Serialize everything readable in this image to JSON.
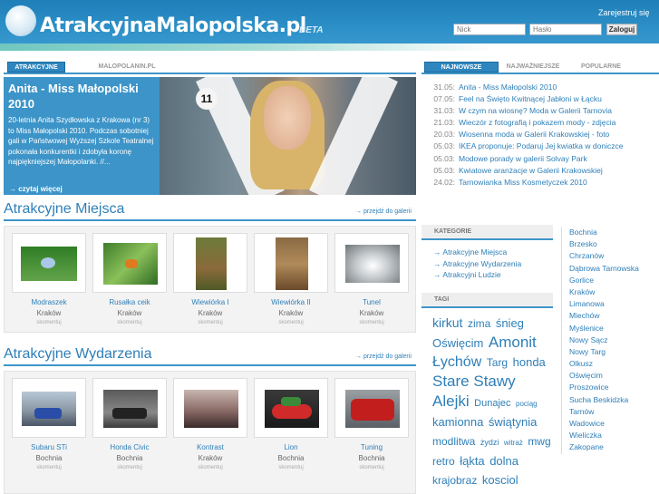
{
  "header": {
    "site_name": "AtrakcyjnaMalopolska.pl",
    "beta": "BETA",
    "register": "Zarejestruj się",
    "login_placeholder": "Nick",
    "password_placeholder": "Hasło",
    "login_button": "Zaloguj"
  },
  "left_tabs": [
    "ATRAKCYJNE",
    "MALOPOLANIN.PL"
  ],
  "right_tabs": [
    "NAJNOWSZE",
    "NAJWAŻNIEJSZE",
    "POPULARNE"
  ],
  "featured": {
    "title": "Anita - Miss Małopolski 2010",
    "description": "20-letnia Anita Szydłowska z Krakowa (nr 3) to Miss Małopolski 2010. Podczas sobotniej gali w Państwowej Wyższej Szkole Teatralnej pokonała konkurentki i zdobyła koronę najpiękniejszej Małopolanki. //...",
    "more": "czytaj więcej",
    "number": "11"
  },
  "news": [
    {
      "date": "31.05:",
      "title": "Anita - Miss Małopolski 2010"
    },
    {
      "date": "07.05:",
      "title": "Feel na Święto Kwitnącej Jabłoni w Łącku"
    },
    {
      "date": "31.03:",
      "title": "W czym na wiosnę? Moda w Galerii Tarnovia"
    },
    {
      "date": "21.03:",
      "title": "Wieczór z fotografią i pokazem mody - zdjęcia"
    },
    {
      "date": "20.03:",
      "title": "Wiosenna moda w Galerii Krakowskiej - foto"
    },
    {
      "date": "05.03:",
      "title": "IKEA proponuje: Podaruj Jej kwiatka w doniczce"
    },
    {
      "date": "05.03:",
      "title": "Modowe porady w galerii Solvay Park"
    },
    {
      "date": "05.03:",
      "title": "Kwiatowe aranżacje w Galerii Krakowskiej"
    },
    {
      "date": "24.02:",
      "title": "Tarnowianka Miss Kosmetyczek 2010"
    }
  ],
  "places": {
    "title": "Atrakcyjne Miejsca",
    "link": "przejdź do galerii",
    "items": [
      {
        "title": "Modraszek",
        "location": "Kraków",
        "comments": "skomentuj"
      },
      {
        "title": "Rusałka ceik",
        "location": "Kraków",
        "comments": "skomentuj"
      },
      {
        "title": "Wiewiórka I",
        "location": "Kraków",
        "comments": "skomentuj"
      },
      {
        "title": "Wiewiórka II",
        "location": "Kraków",
        "comments": "skomentuj"
      },
      {
        "title": "Tunel",
        "location": "Kraków",
        "comments": "skomentuj"
      }
    ]
  },
  "events": {
    "title": "Atrakcyjne Wydarzenia",
    "link": "przejdź do galerii",
    "items": [
      {
        "title": "Subaru STi",
        "location": "Bochnia",
        "comments": "skomentuj"
      },
      {
        "title": "Honda Civic",
        "location": "Bochnia",
        "comments": "skomentuj"
      },
      {
        "title": "Kontrast",
        "location": "Kraków",
        "comments": "skomentuj"
      },
      {
        "title": "Lion",
        "location": "Bochnia",
        "comments": "skomentuj"
      },
      {
        "title": "Tuning",
        "location": "Bochnia",
        "comments": "skomentuj"
      }
    ]
  },
  "categories": {
    "title": "KATEGORIE",
    "items": [
      "Atrakcyjne Miejsca",
      "Atrakcyjne Wydarzenia",
      "Atrakcyjni Ludzie"
    ]
  },
  "tags": {
    "title": "TAGI",
    "items": [
      {
        "text": "kirkut",
        "size": 14
      },
      {
        "text": "zima",
        "size": 12
      },
      {
        "text": "śnieg",
        "size": 13
      },
      {
        "text": "Oświęcim",
        "size": 13
      },
      {
        "text": "Amonit",
        "size": 17
      },
      {
        "text": "Łychów",
        "size": 16
      },
      {
        "text": "Targ",
        "size": 12
      },
      {
        "text": "honda",
        "size": 13
      },
      {
        "text": "Stare Stawy",
        "size": 17
      },
      {
        "text": "Alejki",
        "size": 17
      },
      {
        "text": "Dunajec",
        "size": 11
      },
      {
        "text": "pociąg",
        "size": 8
      },
      {
        "text": "kamionna",
        "size": 13
      },
      {
        "text": "świątynia",
        "size": 13
      },
      {
        "text": "modlitwa",
        "size": 12
      },
      {
        "text": "żydzi",
        "size": 9
      },
      {
        "text": "witraż",
        "size": 8
      },
      {
        "text": "mwg",
        "size": 12
      },
      {
        "text": "retro",
        "size": 12
      },
      {
        "text": "łąkta",
        "size": 13
      },
      {
        "text": "dolna",
        "size": 13
      },
      {
        "text": "krajobraz",
        "size": 12
      },
      {
        "text": "kosciol",
        "size": 13
      }
    ]
  },
  "cities": [
    "Bochnia",
    "Brzesko",
    "Chrzanów",
    "Dąbrowa Tarnowska",
    "Gorlice",
    "Kraków",
    "Limanowa",
    "Miechów",
    "Myślenice",
    "Nowy Sącz",
    "Nowy Targ",
    "Olkusz",
    "Oświęcim",
    "Proszowice",
    "Sucha Beskidzka",
    "Tarnów",
    "Wadowice",
    "Wieliczka",
    "Zakopane"
  ],
  "colors": {
    "accent": "#2e7fb8",
    "header": "#2e91c8",
    "stripe": "#6fc7c0"
  }
}
